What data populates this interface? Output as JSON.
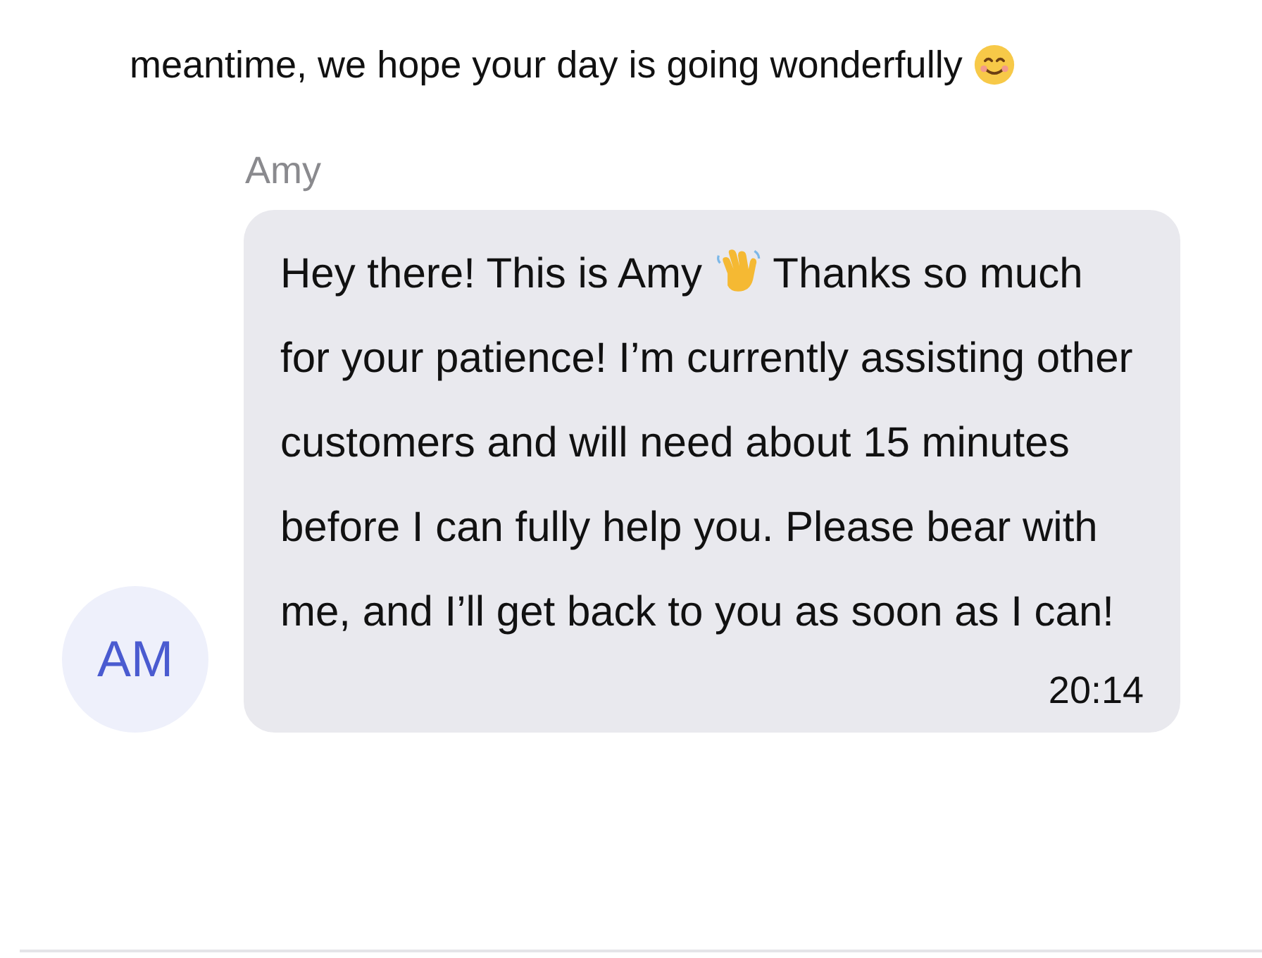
{
  "previous_message": {
    "text": "meantime, we hope your day is going wonderfully"
  },
  "message": {
    "sender": "Amy",
    "text_before_icon": "Hey there! This is Amy",
    "text_after_icon": "Thanks so much for your patience! I’m currently assisting other customers and will need about 15 minutes before I can fully help you. Please bear with me, and I’ll get back to you as soon as I can!",
    "time": "20:14"
  },
  "avatar": {
    "initials": "AM"
  }
}
